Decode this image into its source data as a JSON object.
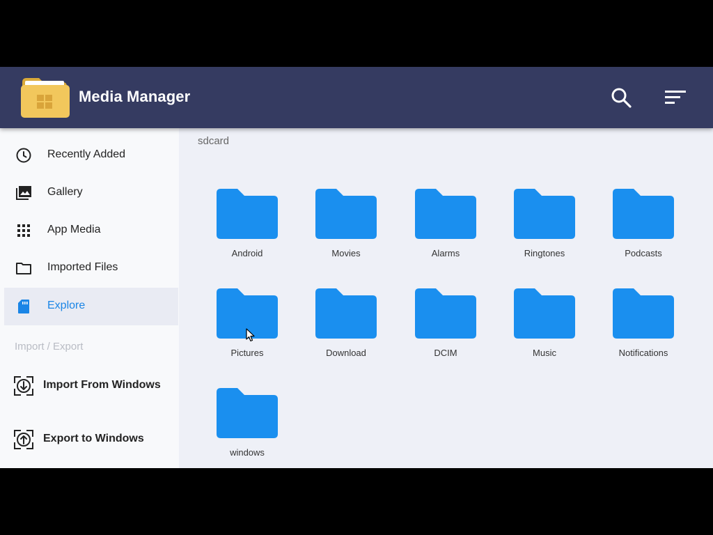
{
  "app": {
    "title": "Media Manager",
    "accent_color": "#353b61",
    "highlight_color": "#1a85e6",
    "folder_color": "#1a8fef"
  },
  "appbar": {
    "search_icon": "search-icon",
    "sort_icon": "sort-icon"
  },
  "sidebar": {
    "items": [
      {
        "label": "Recently Added",
        "icon": "clock-icon"
      },
      {
        "label": "Gallery",
        "icon": "gallery-icon"
      },
      {
        "label": "App Media",
        "icon": "grid-icon"
      },
      {
        "label": "Imported Files",
        "icon": "folder-outline-icon"
      },
      {
        "label": "Explore",
        "icon": "sdcard-icon",
        "active": true
      }
    ],
    "section_header": "Import / Export",
    "io_items": [
      {
        "label": "Import From Windows",
        "icon": "import-icon"
      },
      {
        "label": "Export to Windows",
        "icon": "export-icon"
      }
    ]
  },
  "content": {
    "breadcrumb": "sdcard",
    "folders": [
      "Android",
      "Movies",
      "Alarms",
      "Ringtones",
      "Podcasts",
      "Pictures",
      "Download",
      "DCIM",
      "Music",
      "Notifications",
      "windows"
    ]
  }
}
